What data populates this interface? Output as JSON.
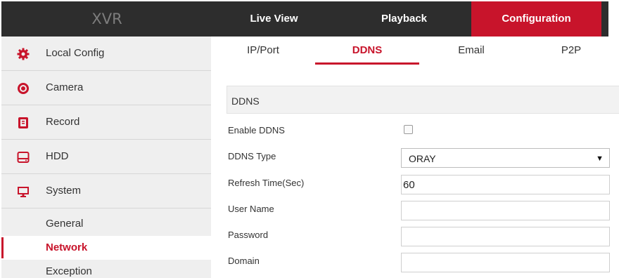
{
  "app": {
    "title": "XVR"
  },
  "nav": {
    "items": [
      {
        "label": "Live View"
      },
      {
        "label": "Playback"
      },
      {
        "label": "Configuration"
      }
    ],
    "active": "Configuration",
    "accent_color": "#c8142b"
  },
  "sidebar": {
    "items": [
      {
        "label": "Local Config",
        "icon": "gear-icon"
      },
      {
        "label": "Camera",
        "icon": "camera-icon"
      },
      {
        "label": "Record",
        "icon": "record-icon"
      },
      {
        "label": "HDD",
        "icon": "hdd-icon"
      },
      {
        "label": "System",
        "icon": "monitor-icon"
      }
    ],
    "subitems": [
      {
        "label": "General"
      },
      {
        "label": "Network"
      },
      {
        "label": "Exception"
      }
    ],
    "active_subitem": "Network"
  },
  "tabs": {
    "items": [
      {
        "label": "IP/Port"
      },
      {
        "label": "DDNS"
      },
      {
        "label": "Email"
      },
      {
        "label": "P2P"
      }
    ],
    "active": "DDNS"
  },
  "form": {
    "section_title": "DDNS",
    "enable_label": "Enable DDNS",
    "enable_checked": false,
    "type_label": "DDNS Type",
    "type_value": "ORAY",
    "refresh_label": "Refresh Time(Sec)",
    "refresh_value": "60",
    "username_label": "User Name",
    "username_value": "",
    "password_label": "Password",
    "password_value": "",
    "domain_label": "Domain",
    "domain_value": ""
  }
}
